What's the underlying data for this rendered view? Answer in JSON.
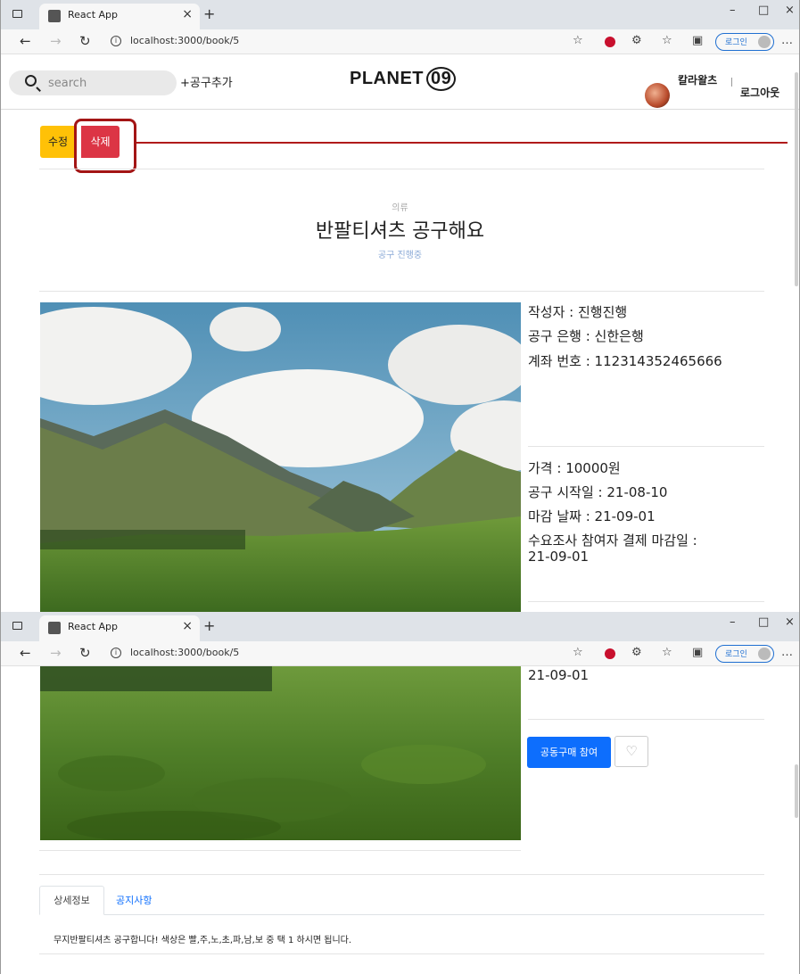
{
  "browser": {
    "tab_title": "React App",
    "tab_close": "×",
    "new_tab": "+",
    "url": "localhost:3000/book/5",
    "window_controls": [
      "–",
      "□",
      "×"
    ],
    "login_pill": "로그인"
  },
  "header": {
    "search_placeholder": "search",
    "add_link": "+공구추가",
    "logo_text": "PLANET",
    "logo_num": "09",
    "username": "칼라왈츠",
    "logout": "로그아웃"
  },
  "actions": {
    "edit_label": "수정",
    "delete_label": "삭제"
  },
  "post": {
    "category": "의류",
    "title": "반팔티셔츠 공구해요",
    "status": "공구 진행중"
  },
  "info": {
    "author": "작성자 : 진행진행",
    "bank": "공구 은행 : 신한은행",
    "account": "계좌 번호 : 112314352465666",
    "price": "가격 : 10000원",
    "start_date": "공구 시작일 : 21-08-10",
    "deadline": "마감 날짜 : 21-09-01",
    "survey_deadline_label": "수요조사 참여자 결제 마감일 :",
    "survey_deadline_value": "21-09-01"
  },
  "buttons": {
    "join": "공동구매 참여",
    "heart": "♡"
  },
  "tabs": {
    "detail": "상세정보",
    "notice": "공지사항"
  },
  "description": "무지반팔티셔츠 공구합니다! 색상은 빨,주,노,초,파,남,보 중 택 1 하시면 됩니다.",
  "colors": {
    "edit": "#ffc107",
    "delete": "#dc3545",
    "primary": "#0d6efd",
    "highlight": "#a31515"
  }
}
